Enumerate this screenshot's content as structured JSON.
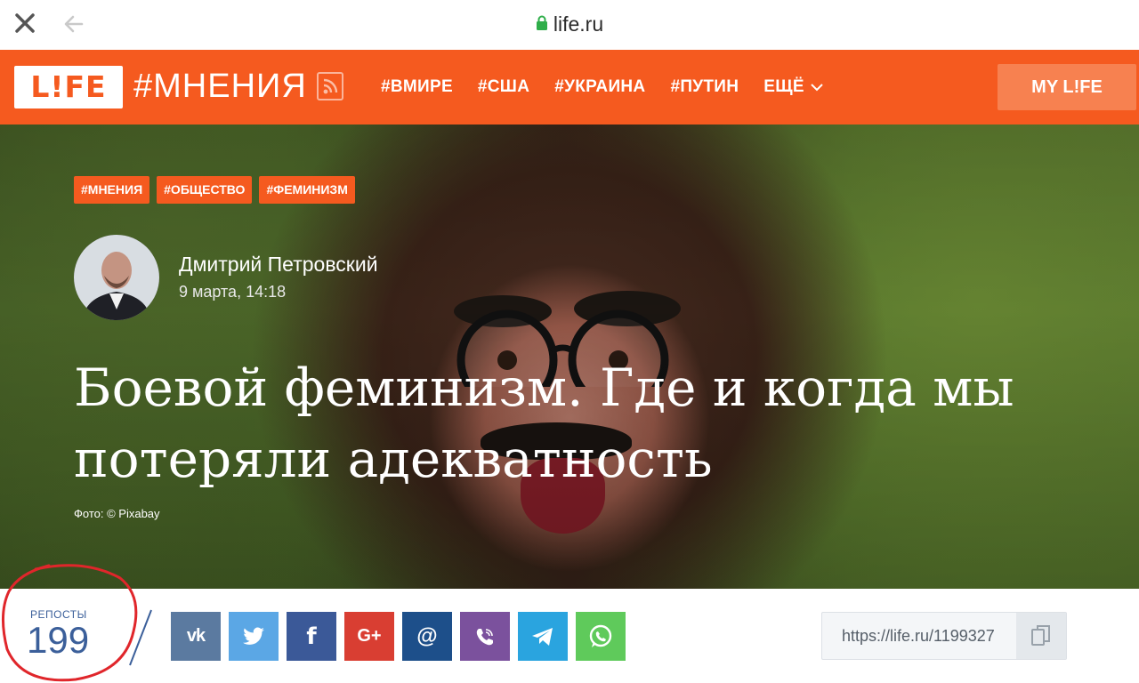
{
  "browser": {
    "url_text": "life.ru"
  },
  "header": {
    "logo_text": "L!FE",
    "section_title": "#МНЕНИЯ",
    "nav": [
      {
        "label": "#ВМИРЕ"
      },
      {
        "label": "#США"
      },
      {
        "label": "#УКРАИНА"
      },
      {
        "label": "#ПУТИН"
      }
    ],
    "more_label": "ЕЩЁ",
    "mylife_label": "MY L!FE"
  },
  "article": {
    "tags": [
      "#МНЕНИЯ",
      "#ОБЩЕСТВО",
      "#ФЕМИНИЗМ"
    ],
    "author_name": "Дмитрий Петровский",
    "date": "9 марта, 14:18",
    "headline_line1": "Боевой феминизм. Где и когда мы",
    "headline_line2": "потеряли адекватность",
    "photo_credit": "Фото: © Pixabay"
  },
  "share": {
    "reposts_label": "РЕПОСТЫ",
    "reposts_count": "199",
    "buttons": [
      {
        "icon": "vk-icon",
        "color": "#5b7aa0"
      },
      {
        "icon": "twitter-icon",
        "color": "#5ba7e5"
      },
      {
        "icon": "facebook-icon",
        "color": "#3b5998"
      },
      {
        "icon": "google-plus-icon",
        "color": "#d93e32"
      },
      {
        "icon": "mail-ru-icon",
        "color": "#1d4f8a"
      },
      {
        "icon": "viber-icon",
        "color": "#7b519d"
      },
      {
        "icon": "telegram-icon",
        "color": "#2aa4df"
      },
      {
        "icon": "whatsapp-icon",
        "color": "#5fca5b"
      }
    ],
    "short_url": "https://life.ru/1199327"
  },
  "colors": {
    "brand_orange": "#f55a1f",
    "annotation_red": "#e0262b"
  }
}
